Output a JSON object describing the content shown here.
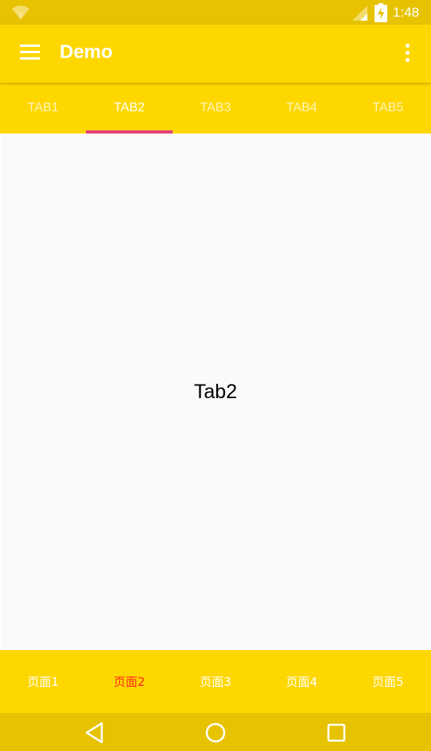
{
  "status_bar": {
    "time": "1:48",
    "icons": [
      "wifi-icon",
      "signal-icon",
      "battery-charging-icon"
    ]
  },
  "app_bar": {
    "title": "Demo",
    "menu_icon": "hamburger-menu-icon",
    "overflow_icon": "more-vert-icon"
  },
  "tabs": [
    {
      "label": "TAB1",
      "active": false
    },
    {
      "label": "TAB2",
      "active": true
    },
    {
      "label": "TAB3",
      "active": false
    },
    {
      "label": "TAB4",
      "active": false
    },
    {
      "label": "TAB5",
      "active": false
    }
  ],
  "content": {
    "label": "Tab2"
  },
  "bottom_nav": [
    {
      "label": "页面1",
      "active": false
    },
    {
      "label": "页面2",
      "active": true
    },
    {
      "label": "页面3",
      "active": false
    },
    {
      "label": "页面4",
      "active": false
    },
    {
      "label": "页面5",
      "active": false
    }
  ],
  "system_nav": {
    "icons": [
      "back-icon",
      "home-icon",
      "recent-apps-icon"
    ]
  },
  "colors": {
    "primary": "#FFD700",
    "primary_dark": "#E6C200",
    "tab_indicator": "#E5407A",
    "bottom_active": "#FF2A1A",
    "content_bg": "#FAFAFA"
  }
}
